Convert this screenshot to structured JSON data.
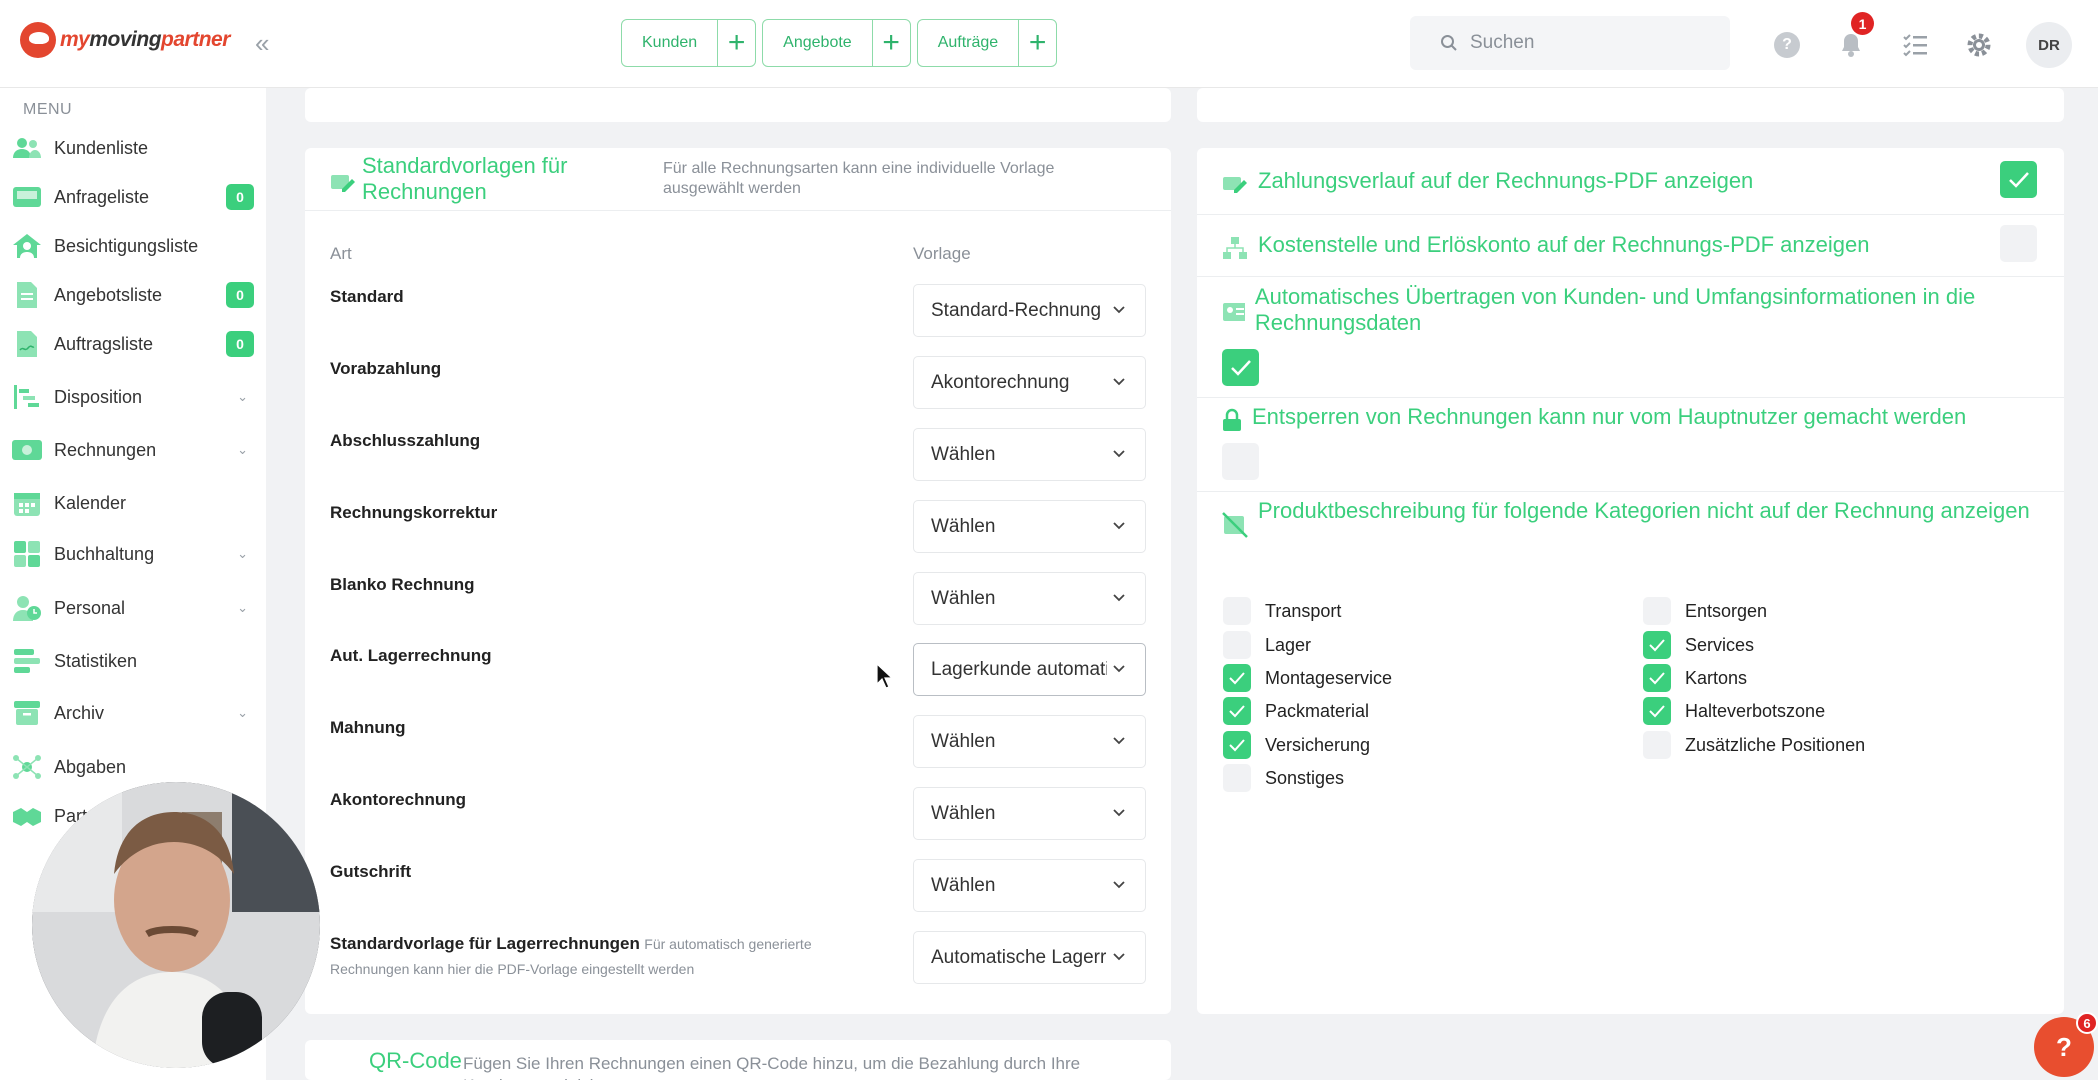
{
  "brand": {
    "logo_part1": "my",
    "logo_part2": "moving",
    "logo_part3": "partner"
  },
  "top_nav": [
    {
      "label": "Kunden"
    },
    {
      "label": "Angebote"
    },
    {
      "label": "Aufträge"
    }
  ],
  "search": {
    "placeholder": "Suchen"
  },
  "notifications": {
    "count": "1"
  },
  "user": {
    "initials": "DR"
  },
  "sidebar": {
    "menu_label": "MENU",
    "items": [
      {
        "label": "Kundenliste"
      },
      {
        "label": "Anfrageliste",
        "badge": "0"
      },
      {
        "label": "Besichtigungsliste"
      },
      {
        "label": "Angebotsliste",
        "badge": "0"
      },
      {
        "label": "Auftragsliste",
        "badge": "0"
      },
      {
        "label": "Disposition"
      },
      {
        "label": "Rechnungen"
      },
      {
        "label": "Kalender"
      },
      {
        "label": "Buchhaltung"
      },
      {
        "label": "Personal"
      },
      {
        "label": "Statistiken"
      },
      {
        "label": "Archiv"
      },
      {
        "label": "Abgaben"
      },
      {
        "label": "Part"
      }
    ]
  },
  "templates_card": {
    "title": "Standardvorlagen für Rechnungen",
    "desc": "Für alle Rechnungsarten kann eine individuelle Vorlage ausgewählt werden",
    "col_art": "Art",
    "col_vorlage": "Vorlage",
    "rows": [
      {
        "art": "Standard",
        "vorlage": "Standard-Rechnung"
      },
      {
        "art": "Vorabzahlung",
        "vorlage": "Akontorechnung"
      },
      {
        "art": "Abschlusszahlung",
        "vorlage": "Wählen"
      },
      {
        "art": "Rechnungskorrektur",
        "vorlage": "Wählen"
      },
      {
        "art": "Blanko Rechnung",
        "vorlage": "Wählen"
      },
      {
        "art": "Aut. Lagerrechnung",
        "vorlage": "Lagerkunde automatisch"
      },
      {
        "art": "Mahnung",
        "vorlage": "Wählen"
      },
      {
        "art": "Akontorechnung",
        "vorlage": "Wählen"
      },
      {
        "art": "Gutschrift",
        "vorlage": "Wählen"
      }
    ],
    "storage_label": "Standardvorlage für Lagerrechnungen",
    "storage_hint": "Für automatisch generierte Rechnungen kann hier die PDF-Vorlage eingestellt werden",
    "storage_value": "Automatische Lagerrechnung"
  },
  "qr_card": {
    "title": "QR-Code",
    "desc": "Fügen Sie Ihren Rechnungen einen QR-Code hinzu, um die Bezahlung durch Ihre Kunden zu erleichtern"
  },
  "settings": {
    "payment_history": {
      "label": "Zahlungsverlauf auf der Rechnungs-PDF anzeigen",
      "checked": true
    },
    "cost_center": {
      "label": "Kostenstelle und Erlöskonto auf der Rechnungs-PDF anzeigen",
      "checked": false
    },
    "auto_transfer": {
      "label": "Automatisches Übertragen von Kunden- und Umfangsinformationen in die Rechnungsdaten",
      "checked": true
    },
    "unlock": {
      "label": "Entsperren von Rechnungen kann nur vom Hauptnutzer gemacht werden",
      "checked": false
    },
    "product_desc": {
      "label": "Produktbeschreibung für folgende Kategorien nicht auf der Rechnung anzeigen"
    }
  },
  "categories": [
    {
      "label": "Transport",
      "checked": false
    },
    {
      "label": "Entsorgen",
      "checked": false
    },
    {
      "label": "Lager",
      "checked": false
    },
    {
      "label": "Services",
      "checked": true
    },
    {
      "label": "Montageservice",
      "checked": true
    },
    {
      "label": "Kartons",
      "checked": true
    },
    {
      "label": "Packmaterial",
      "checked": true
    },
    {
      "label": "Halteverbotszone",
      "checked": true
    },
    {
      "label": "Versicherung",
      "checked": true
    },
    {
      "label": "Zusätzliche Positionen",
      "checked": false
    },
    {
      "label": "Sonstiges",
      "checked": false
    }
  ],
  "help": {
    "label": "?",
    "badge": "6"
  },
  "colors": {
    "accent": "#3bcf7d",
    "brand": "#e3462f",
    "badge": "#e02424"
  }
}
